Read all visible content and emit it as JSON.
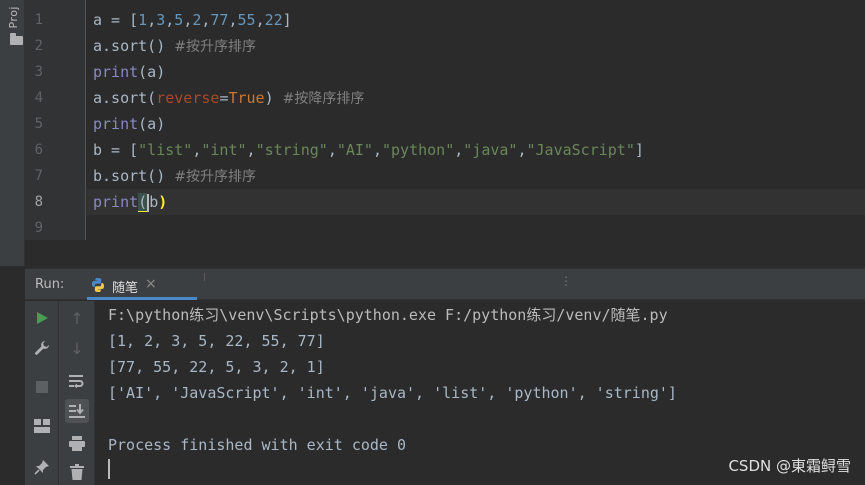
{
  "project_tab": {
    "label": "Proj"
  },
  "editor": {
    "line_numbers": [
      "1",
      "2",
      "3",
      "4",
      "5",
      "6",
      "7",
      "8",
      "9"
    ],
    "active_line": 8,
    "lines": [
      "a = [1,3,5,2,77,55,22]",
      "a.sort() #按升序排序",
      "print(a)",
      "a.sort(reverse=True) #按降序排序",
      "print(a)",
      "b = [\"list\",\"int\",\"string\",\"AI\",\"python\",\"java\",\"JavaScript\"]",
      "b.sort() #按升序排序",
      "print(b)",
      ""
    ]
  },
  "run_panel": {
    "label": "Run:",
    "tab_name": "随笔",
    "tab_close": "×",
    "toolbar": {
      "run_icon": "play-icon",
      "wrench_icon": "wrench-icon",
      "stop_icon": "stop-icon",
      "layout_icon": "layout-icon",
      "pin_icon": "pin-icon",
      "up_icon": "arrow-up-icon",
      "down_icon": "arrow-down-icon",
      "wrap_icon": "soft-wrap-icon",
      "scroll_icon": "scroll-to-end-icon",
      "print_icon": "print-icon",
      "delete_icon": "trash-icon"
    },
    "console": [
      "F:\\python练习\\venv\\Scripts\\python.exe F:/python练习/venv/随笔.py",
      "[1, 2, 3, 5, 22, 55, 77]",
      "[77, 55, 22, 5, 3, 2, 1]",
      "['AI', 'JavaScript', 'int', 'java', 'list', 'python', 'string']",
      "",
      "Process finished with exit code 0"
    ]
  },
  "watermark": "CSDN @東霜鲟雪",
  "colors": {
    "background": "#2b2b2b",
    "number": "#6897bb",
    "string": "#6a8759",
    "comment": "#808080",
    "builtin": "#8888c6",
    "param": "#aa4926",
    "keyword": "#cc7832",
    "run_green": "#499c54",
    "tab_underline": "#4a88c7"
  }
}
